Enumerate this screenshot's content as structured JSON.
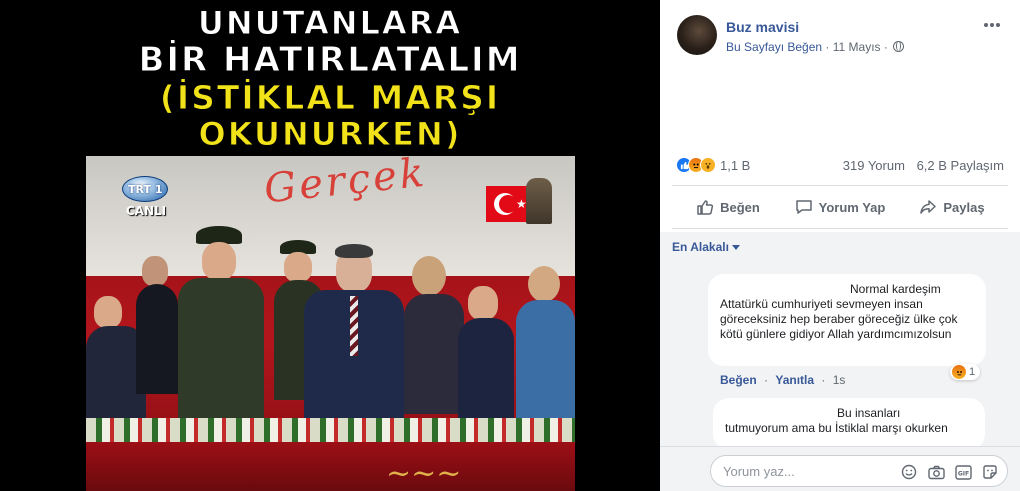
{
  "image": {
    "headline_lines": [
      "UNUTANLARA",
      "BİR HATIRLATALIM",
      "(İSTİKLAL MARŞI",
      "OKUNURKEN)"
    ],
    "channel_logo_text": "TRT 1",
    "channel_live_text": "CANLI",
    "overlay_scrawl": "Gerçek"
  },
  "post": {
    "author": "Buz mavisi",
    "like_page_label": "Bu Sayfayı Beğen",
    "separator": "·",
    "date": "11 Mayıs",
    "privacy_icon": "globe-icon",
    "more_icon": "more-options-icon",
    "reactions": [
      "like",
      "angry",
      "wow"
    ],
    "reaction_count": "1,1 B",
    "comment_count": "319 Yorum",
    "share_count": "6,2 B Paylaşım",
    "actions": {
      "like": "Beğen",
      "comment": "Yorum Yap",
      "share": "Paylaş"
    }
  },
  "comments": {
    "sort_label": "En Alakalı",
    "items": [
      {
        "first_line": "Normal kardeşim",
        "body": "Attatürkü cumhuriyeti sevmeyen insan göreceksiniz hep beraber göreceğiz ülke çok kötü günlere gidiyor Allah yardımcımızolsun",
        "like_label": "Beğen",
        "reply_label": "Yanıtla",
        "separator": "·",
        "time": "1s",
        "reaction": "angry",
        "reaction_count": "1"
      },
      {
        "first_line": "Bu insanları",
        "body": "tutmuyorum ama bu İstiklal marşı okurken"
      }
    ]
  },
  "composer": {
    "placeholder": "Yorum yaz...",
    "tools": [
      "emoji-icon",
      "camera-icon",
      "gif-icon",
      "sticker-icon"
    ]
  },
  "colors": {
    "link": "#385898",
    "muted": "#606770",
    "headline_white": "#ffffff",
    "headline_yellow": "#f2e21a",
    "like_blue": "#1877f2"
  }
}
